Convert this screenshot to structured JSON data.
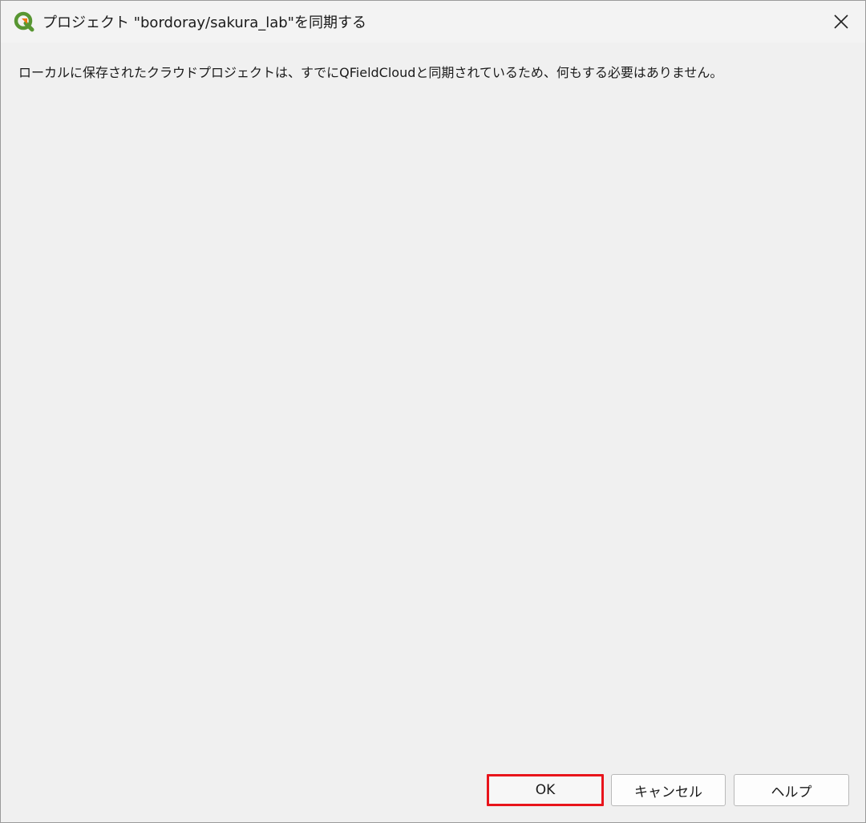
{
  "window": {
    "title": "プロジェクト \"bordoray/sakura_lab\"を同期する",
    "app_icon": "qgis-icon",
    "close_icon": "close-icon"
  },
  "message": "ローカルに保存されたクラウドプロジェクトは、すでにQFieldCloudと同期されているため、何もする必要はありません。",
  "buttons": {
    "ok_label": "OK",
    "cancel_label": "キャンセル",
    "help_label": "ヘルプ"
  },
  "colors": {
    "highlight": "#e8141b",
    "qgis_green": "#589632",
    "qgis_yellow": "#ee7913"
  }
}
